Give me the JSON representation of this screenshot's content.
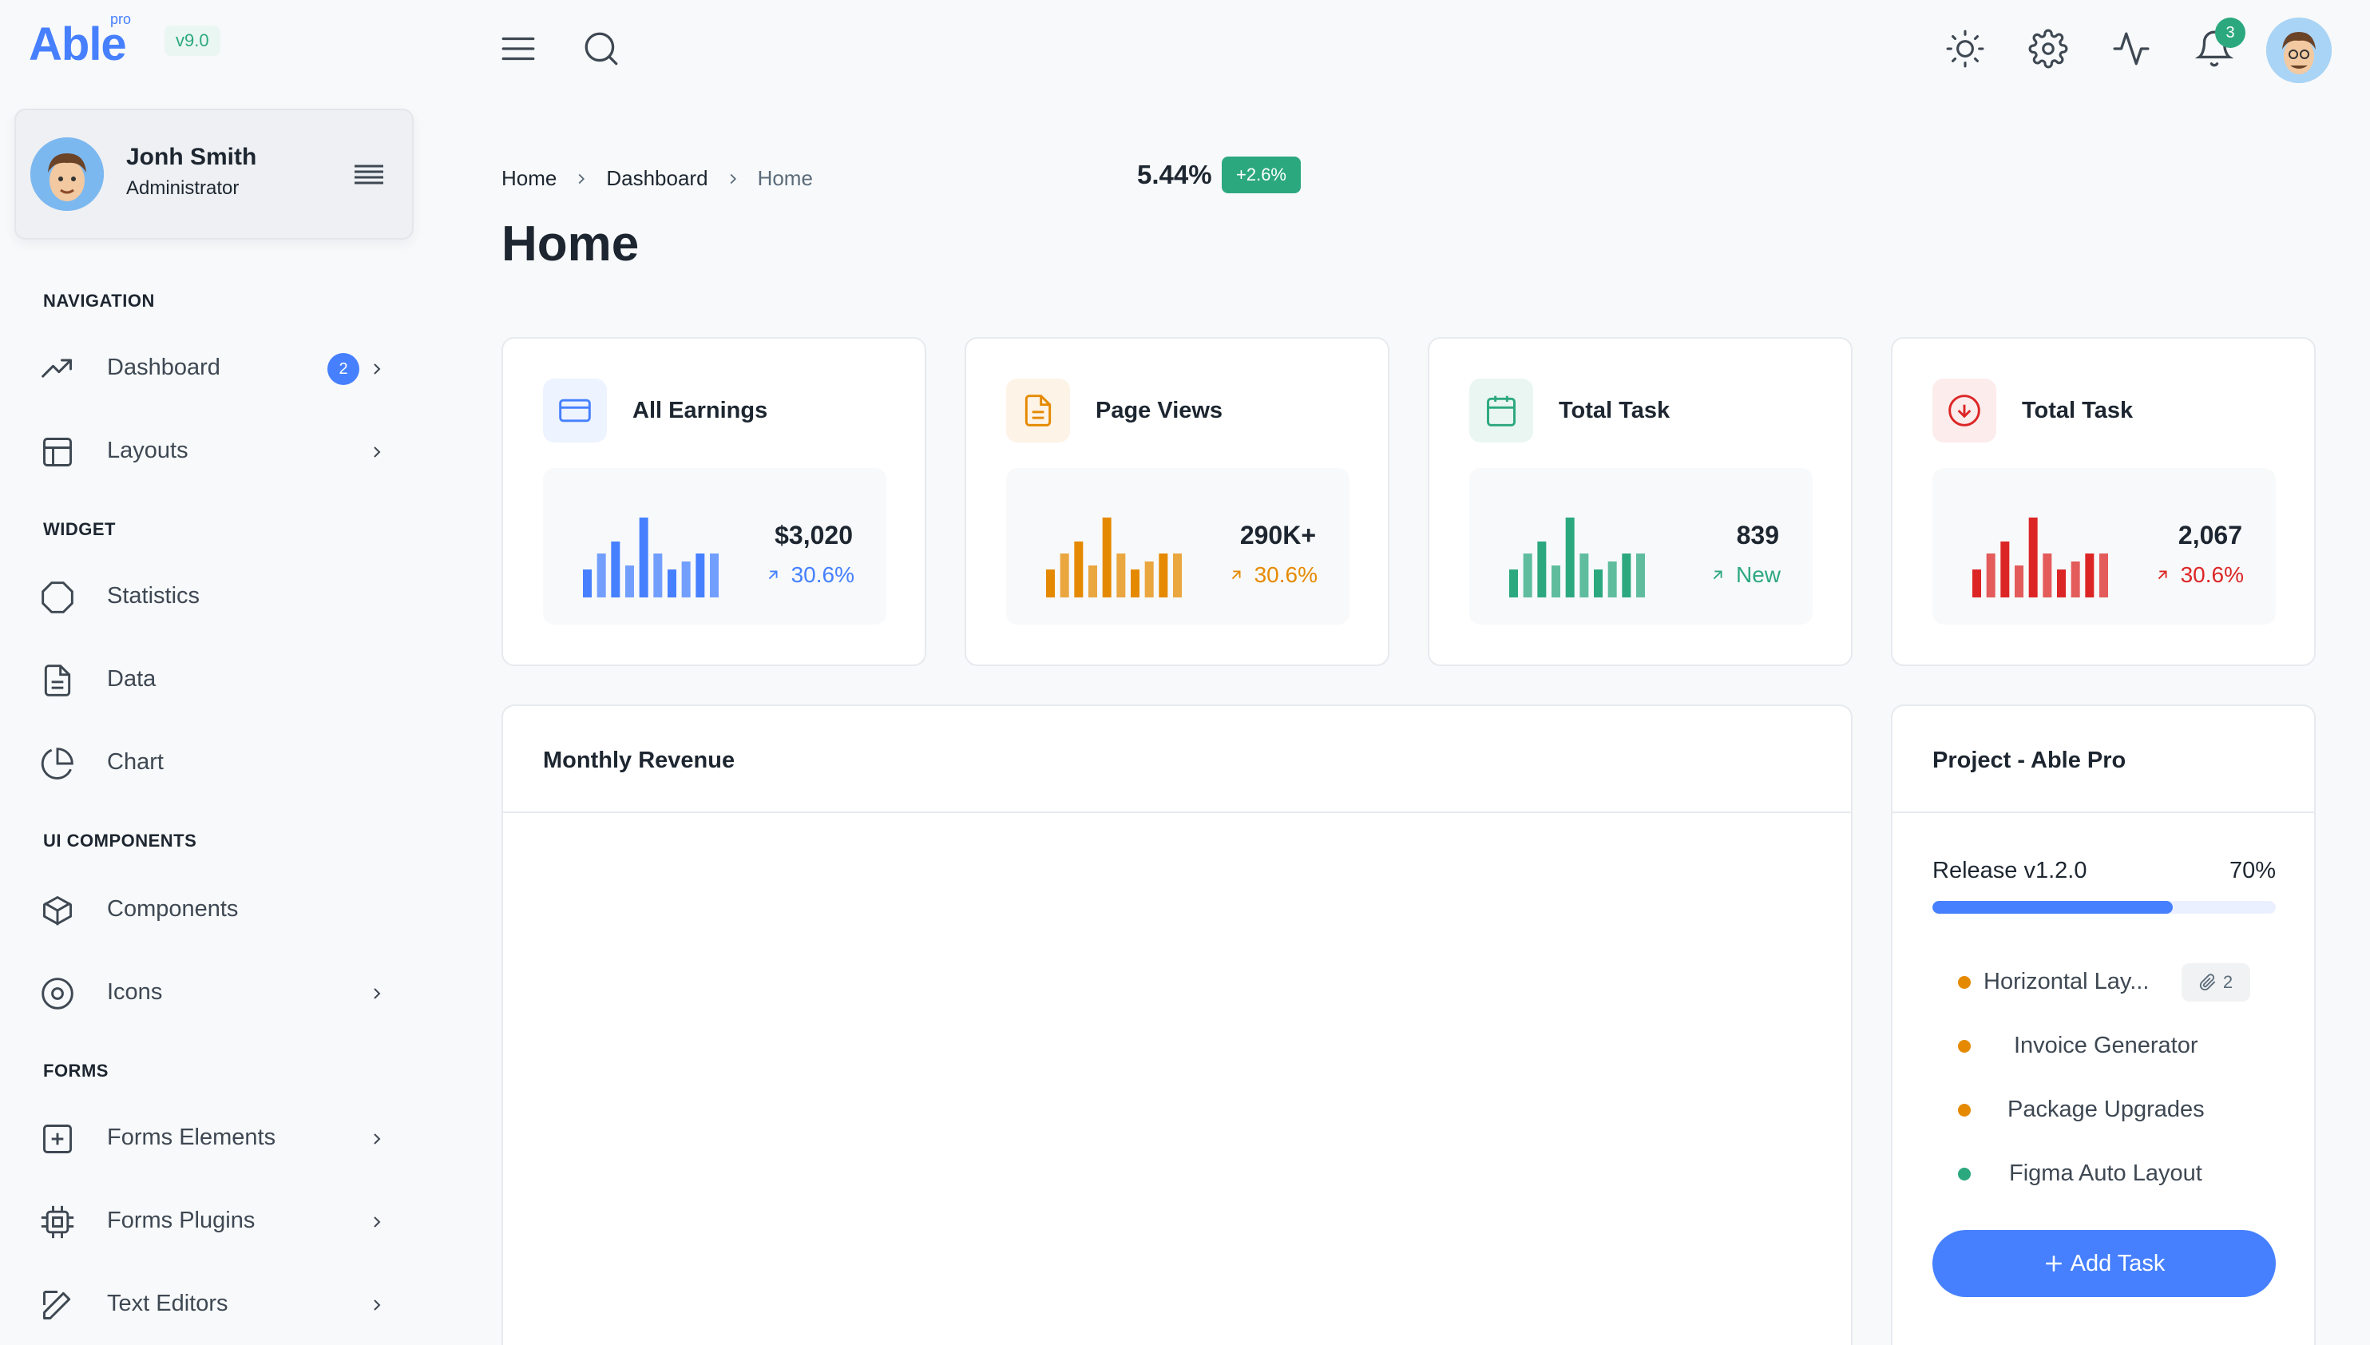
{
  "app": {
    "logo": "Able",
    "logo_tag": "pro",
    "version": "v9.0"
  },
  "user": {
    "name": "Jonh Smith",
    "role": "Administrator"
  },
  "sidebar": {
    "sections": [
      {
        "caption": "NAVIGATION"
      },
      {
        "caption": "WIDGET"
      },
      {
        "caption": "UI COMPONENTS"
      },
      {
        "caption": "FORMS"
      }
    ],
    "items": [
      {
        "label": "Dashboard",
        "icon": "trending-up-icon",
        "badge": "2"
      },
      {
        "label": "Layouts",
        "icon": "layout-icon"
      },
      {
        "label": "Statistics",
        "icon": "octagon-icon"
      },
      {
        "label": "Data",
        "icon": "file-text-icon"
      },
      {
        "label": "Chart",
        "icon": "pie-chart-icon"
      },
      {
        "label": "Components",
        "icon": "box-icon"
      },
      {
        "label": "Icons",
        "icon": "target-icon"
      },
      {
        "label": "Forms Elements",
        "icon": "plus-square-icon"
      },
      {
        "label": "Forms Plugins",
        "icon": "cpu-icon"
      },
      {
        "label": "Text Editors",
        "icon": "edit-icon"
      }
    ]
  },
  "header": {
    "icons": [
      "menu-icon",
      "search-icon",
      "sun-icon",
      "settings-icon",
      "activity-icon",
      "bell-icon"
    ],
    "notification_count": "3"
  },
  "breadcrumb": [
    "Home",
    "Dashboard",
    "Home"
  ],
  "page_title": "Home",
  "stats": [
    {
      "title": "All Earnings",
      "value": "$3,020",
      "trend": "30.6%",
      "color": "#4680ff",
      "bg": "#edf3ff",
      "icon": "credit-card-icon",
      "bars": [
        0.35,
        0.55,
        0.7,
        0.4,
        1.0,
        0.55,
        0.35,
        0.45,
        0.55,
        0.55
      ]
    },
    {
      "title": "Page Views",
      "value": "290K+",
      "trend": "30.6%",
      "color": "#e58a00",
      "bg": "#fdf3e6",
      "icon": "file-icon",
      "bars": [
        0.35,
        0.55,
        0.7,
        0.4,
        1.0,
        0.55,
        0.35,
        0.45,
        0.55,
        0.55
      ]
    },
    {
      "title": "Total Task",
      "value": "839",
      "trend": "New",
      "color": "#2ca87f",
      "bg": "#eaf6f1",
      "icon": "calendar-icon",
      "bars": [
        0.35,
        0.55,
        0.7,
        0.4,
        1.0,
        0.55,
        0.35,
        0.45,
        0.55,
        0.55
      ]
    },
    {
      "title": "Total Task",
      "value": "2,067",
      "trend": "30.6%",
      "color": "#dc2626",
      "bg": "#fdecec",
      "icon": "arrow-down-circle-icon",
      "bars": [
        0.35,
        0.55,
        0.7,
        0.4,
        1.0,
        0.55,
        0.35,
        0.45,
        0.55,
        0.55
      ]
    }
  ],
  "revenue": {
    "title": "Monthly Revenue",
    "value": "5.44%",
    "badge": "+2.6%"
  },
  "project": {
    "title": "Project - Able Pro",
    "release_label": "Release v1.2.0",
    "release_percent": "70%",
    "progress": 0.7,
    "attachments": "2",
    "tasks": [
      {
        "label": "Horizontal Lay...",
        "color": "#e58a00"
      },
      {
        "label": "Invoice Generator",
        "color": "#e58a00"
      },
      {
        "label": "Package Upgrades",
        "color": "#e58a00"
      },
      {
        "label": "Figma Auto Layout",
        "color": "#2ca87f"
      }
    ],
    "add_label": "Add Task"
  }
}
